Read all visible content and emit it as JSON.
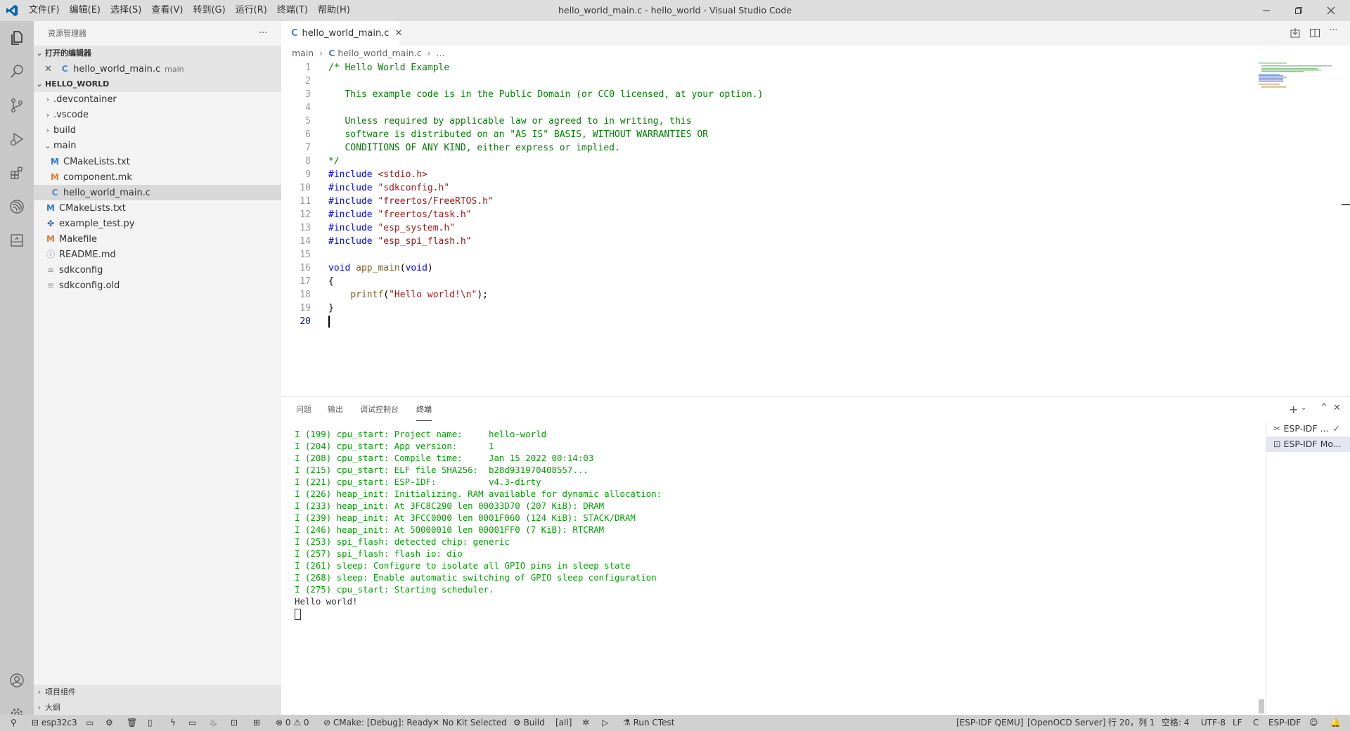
{
  "titlebar": {
    "title": "hello_world_main.c - hello_world - Visual Studio Code",
    "menu": [
      "文件(F)",
      "编辑(E)",
      "选择(S)",
      "查看(V)",
      "转到(G)",
      "运行(R)",
      "终端(T)",
      "帮助(H)"
    ]
  },
  "sidebar": {
    "title": "资源管理器",
    "open_editors_label": "打开的编辑器",
    "open_editor": {
      "name": "hello_world_main.c",
      "desc": "main"
    },
    "project_label": "HELLO_WORLD",
    "items": [
      {
        "label": ".devcontainer"
      },
      {
        "label": ".vscode"
      },
      {
        "label": "build"
      },
      {
        "label": "main"
      },
      {
        "label": "CMakeLists.txt",
        "icon": "M"
      },
      {
        "label": "component.mk",
        "icon": "M"
      },
      {
        "label": "hello_world_main.c",
        "icon": "C"
      },
      {
        "label": "CMakeLists.txt",
        "icon": "M"
      },
      {
        "label": "example_test.py"
      },
      {
        "label": "Makefile",
        "icon": "M"
      },
      {
        "label": "README.md"
      },
      {
        "label": "sdkconfig"
      },
      {
        "label": "sdkconfig.old"
      }
    ],
    "bottom_sections": [
      "项目组件",
      "大纲"
    ]
  },
  "editor": {
    "tab_label": "hello_world_main.c",
    "breadcrumb": {
      "folder": "main",
      "file": "hello_world_main.c",
      "more": "..."
    },
    "lines": [
      {
        "n": "1",
        "parts": [
          [
            "cm",
            "/* Hello World Example"
          ]
        ]
      },
      {
        "n": "2",
        "parts": []
      },
      {
        "n": "3",
        "parts": [
          [
            "cm",
            "   This example code is in the Public Domain (or CC0 licensed, at your option.)"
          ]
        ]
      },
      {
        "n": "4",
        "parts": []
      },
      {
        "n": "5",
        "parts": [
          [
            "cm",
            "   Unless required by applicable law or agreed to in writing, this"
          ]
        ]
      },
      {
        "n": "6",
        "parts": [
          [
            "cm",
            "   software is distributed on an \"AS IS\" BASIS, WITHOUT WARRANTIES OR"
          ]
        ]
      },
      {
        "n": "7",
        "parts": [
          [
            "cm",
            "   CONDITIONS OF ANY KIND, either express or implied."
          ]
        ]
      },
      {
        "n": "8",
        "parts": [
          [
            "cm",
            "*/"
          ]
        ]
      },
      {
        "n": "9",
        "parts": [
          [
            "pp",
            "#include "
          ],
          [
            "st",
            "<stdio.h>"
          ]
        ]
      },
      {
        "n": "10",
        "parts": [
          [
            "pp",
            "#include "
          ],
          [
            "st",
            "\"sdkconfig.h\""
          ]
        ]
      },
      {
        "n": "11",
        "parts": [
          [
            "pp",
            "#include "
          ],
          [
            "st",
            "\"freertos/FreeRTOS.h\""
          ]
        ]
      },
      {
        "n": "12",
        "parts": [
          [
            "pp",
            "#include "
          ],
          [
            "st",
            "\"freertos/task.h\""
          ]
        ]
      },
      {
        "n": "13",
        "parts": [
          [
            "pp",
            "#include "
          ],
          [
            "st",
            "\"esp_system.h\""
          ]
        ]
      },
      {
        "n": "14",
        "parts": [
          [
            "pp",
            "#include "
          ],
          [
            "st",
            "\"esp_spi_flash.h\""
          ]
        ]
      },
      {
        "n": "15",
        "parts": []
      },
      {
        "n": "16",
        "parts": [
          [
            "kw",
            "void"
          ],
          [
            "pl",
            " "
          ],
          [
            "fn",
            "app_main"
          ],
          [
            "pl",
            "("
          ],
          [
            "kw",
            "void"
          ],
          [
            "pl",
            ")"
          ]
        ]
      },
      {
        "n": "17",
        "parts": [
          [
            "pl",
            "{"
          ]
        ]
      },
      {
        "n": "18",
        "parts": [
          [
            "pl",
            "    "
          ],
          [
            "fn",
            "printf"
          ],
          [
            "pl",
            "("
          ],
          [
            "st",
            "\"Hello world!\\n\""
          ],
          [
            "pl",
            ");"
          ]
        ]
      },
      {
        "n": "19",
        "parts": [
          [
            "pl",
            "}"
          ]
        ]
      },
      {
        "n": "20",
        "parts": []
      }
    ]
  },
  "panel": {
    "tabs": [
      "问题",
      "输出",
      "调试控制台",
      "终端"
    ],
    "terminal_lines": [
      "I (199) cpu_start: Project name:     hello-world",
      "I (204) cpu_start: App version:      1",
      "I (208) cpu_start: Compile time:     Jan 15 2022 00:14:03",
      "I (215) cpu_start: ELF file SHA256:  b28d931970408557...",
      "I (221) cpu_start: ESP-IDF:          v4.3-dirty",
      "I (226) heap_init: Initializing. RAM available for dynamic allocation:",
      "I (233) heap_init: At 3FC8C290 len 00033D70 (207 KiB): DRAM",
      "I (239) heap_init: At 3FCC0000 len 0001F060 (124 KiB): STACK/DRAM",
      "I (246) heap_init: At 50000010 len 00001FF0 (7 KiB): RTCRAM",
      "I (253) spi_flash: detected chip: generic",
      "I (257) spi_flash: flash io: dio",
      "I (261) sleep: Configure to isolate all GPIO pins in sleep state",
      "I (268) sleep: Enable automatic switching of GPIO sleep configuration",
      "I (275) cpu_start: Starting scheduler.",
      "Hello world!"
    ],
    "terminals": [
      "ESP-IDF ...",
      "ESP-IDF Mo..."
    ]
  },
  "statusbar": {
    "target": "esp32c3",
    "problems": "0",
    "warnings": "0",
    "cmake": "CMake: [Debug]: Ready",
    "kit": "No Kit Selected",
    "build": "Build",
    "all": "[all]",
    "ctest": "Run CTest",
    "qemu": "[ESP-IDF QEMU]",
    "openocd": "[OpenOCD Server]",
    "position": "行 20，列 1",
    "spaces": "空格: 4",
    "encoding": "UTF-8",
    "eol": "LF",
    "lang": "C",
    "idf": "ESP-IDF"
  }
}
